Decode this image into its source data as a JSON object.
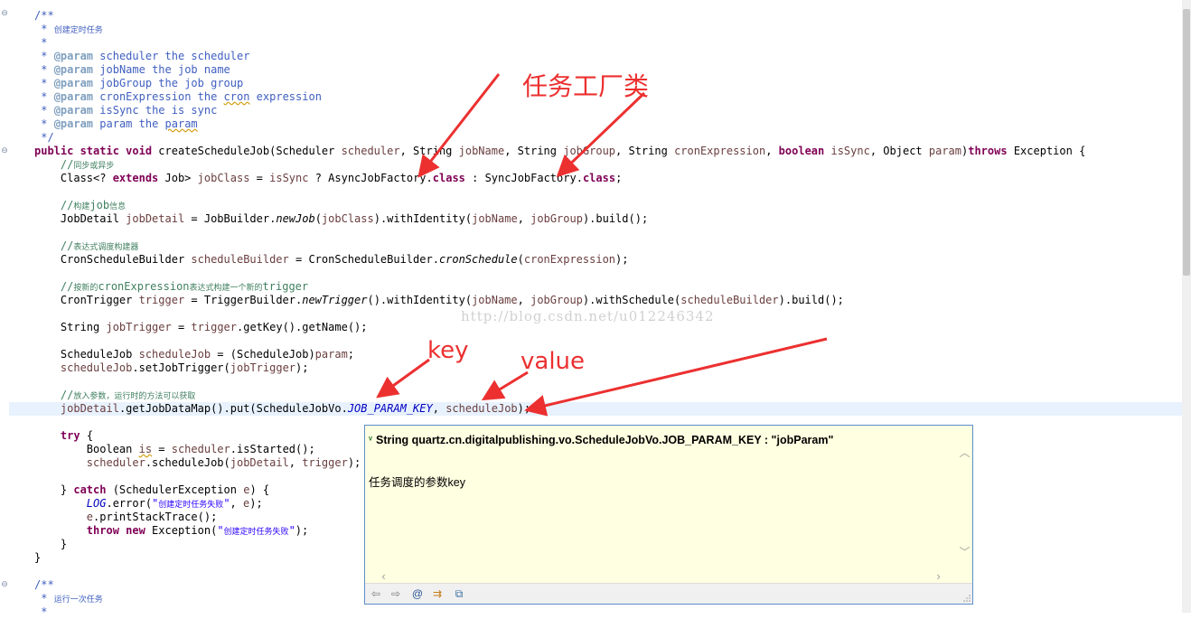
{
  "editor": {
    "lines": [
      {
        "parts": [
          {
            "t": "/**",
            "c": "doc"
          }
        ]
      },
      {
        "parts": [
          {
            "t": " * ",
            "c": "doc"
          },
          {
            "t": "创建定时任务",
            "c": "doc cjk"
          }
        ]
      },
      {
        "parts": [
          {
            "t": " *",
            "c": "doc"
          }
        ]
      },
      {
        "parts": [
          {
            "t": " * ",
            "c": "doc"
          },
          {
            "t": "@param",
            "c": "tag"
          },
          {
            "t": " scheduler the scheduler",
            "c": "doc"
          }
        ]
      },
      {
        "parts": [
          {
            "t": " * ",
            "c": "doc"
          },
          {
            "t": "@param",
            "c": "tag"
          },
          {
            "t": " jobName the job name",
            "c": "doc"
          }
        ]
      },
      {
        "parts": [
          {
            "t": " * ",
            "c": "doc"
          },
          {
            "t": "@param",
            "c": "tag"
          },
          {
            "t": " jobGroup the job group",
            "c": "doc"
          }
        ]
      },
      {
        "parts": [
          {
            "t": " * ",
            "c": "doc"
          },
          {
            "t": "@param",
            "c": "tag"
          },
          {
            "t": " cronExpression the ",
            "c": "doc"
          },
          {
            "t": "cron",
            "c": "doc sq"
          },
          {
            "t": " expression",
            "c": "doc"
          }
        ]
      },
      {
        "parts": [
          {
            "t": " * ",
            "c": "doc"
          },
          {
            "t": "@param",
            "c": "tag"
          },
          {
            "t": " isSync the is sync",
            "c": "doc"
          }
        ]
      },
      {
        "parts": [
          {
            "t": " * ",
            "c": "doc"
          },
          {
            "t": "@param",
            "c": "tag"
          },
          {
            "t": " param the ",
            "c": "doc"
          },
          {
            "t": "param",
            "c": "doc sq"
          }
        ]
      },
      {
        "parts": [
          {
            "t": " */",
            "c": "doc"
          }
        ]
      },
      {
        "parts": [
          {
            "t": "public static void",
            "c": "kw"
          },
          {
            "t": " createScheduleJob(Scheduler "
          },
          {
            "t": "scheduler",
            "c": "var"
          },
          {
            "t": ", String "
          },
          {
            "t": "jobName",
            "c": "var"
          },
          {
            "t": ", String "
          },
          {
            "t": "jobGroup",
            "c": "var"
          },
          {
            "t": ", String "
          },
          {
            "t": "cronExpression",
            "c": "var"
          },
          {
            "t": ", "
          },
          {
            "t": "boolean",
            "c": "kw"
          },
          {
            "t": " "
          },
          {
            "t": "isSync",
            "c": "var"
          },
          {
            "t": ", Object "
          },
          {
            "t": "param",
            "c": "var"
          },
          {
            "t": ")"
          },
          {
            "t": "throws",
            "c": "kw"
          },
          {
            "t": " Exception {"
          }
        ]
      },
      {
        "parts": [
          {
            "t": "    //",
            "c": "cm"
          },
          {
            "t": "同步或异步",
            "c": "cm cjk"
          }
        ]
      },
      {
        "parts": [
          {
            "t": "    Class<? "
          },
          {
            "t": "extends",
            "c": "kw"
          },
          {
            "t": " Job> "
          },
          {
            "t": "jobClass",
            "c": "var"
          },
          {
            "t": " = "
          },
          {
            "t": "isSync",
            "c": "var"
          },
          {
            "t": " ? AsyncJobFactory."
          },
          {
            "t": "class",
            "c": "kw"
          },
          {
            "t": " : SyncJobFactory."
          },
          {
            "t": "class",
            "c": "kw"
          },
          {
            "t": ";"
          }
        ]
      },
      {
        "parts": [
          {
            "t": ""
          }
        ]
      },
      {
        "parts": [
          {
            "t": "    //",
            "c": "cm"
          },
          {
            "t": "构建",
            "c": "cm cjk"
          },
          {
            "t": "job",
            "c": "cm"
          },
          {
            "t": "信息",
            "c": "cm cjk"
          }
        ]
      },
      {
        "parts": [
          {
            "t": "    JobDetail "
          },
          {
            "t": "jobDetail",
            "c": "var"
          },
          {
            "t": " = JobBuilder."
          },
          {
            "t": "newJob",
            "c": "it"
          },
          {
            "t": "("
          },
          {
            "t": "jobClass",
            "c": "var"
          },
          {
            "t": ").withIdentity("
          },
          {
            "t": "jobName",
            "c": "var"
          },
          {
            "t": ", "
          },
          {
            "t": "jobGroup",
            "c": "var"
          },
          {
            "t": ").build();"
          }
        ]
      },
      {
        "parts": [
          {
            "t": ""
          }
        ]
      },
      {
        "parts": [
          {
            "t": "    //",
            "c": "cm"
          },
          {
            "t": "表达式调度构建器",
            "c": "cm cjk"
          }
        ]
      },
      {
        "parts": [
          {
            "t": "    CronScheduleBuilder "
          },
          {
            "t": "scheduleBuilder",
            "c": "var"
          },
          {
            "t": " = CronScheduleBuilder."
          },
          {
            "t": "cronSchedule",
            "c": "it"
          },
          {
            "t": "("
          },
          {
            "t": "cronExpression",
            "c": "var"
          },
          {
            "t": ");"
          }
        ]
      },
      {
        "parts": [
          {
            "t": ""
          }
        ]
      },
      {
        "parts": [
          {
            "t": "    //",
            "c": "cm"
          },
          {
            "t": "按新的",
            "c": "cm cjk"
          },
          {
            "t": "cronExpression",
            "c": "cm"
          },
          {
            "t": "表达式构建一个新的",
            "c": "cm cjk"
          },
          {
            "t": "trigger",
            "c": "cm"
          }
        ]
      },
      {
        "parts": [
          {
            "t": "    CronTrigger "
          },
          {
            "t": "trigger",
            "c": "var"
          },
          {
            "t": " = TriggerBuilder."
          },
          {
            "t": "newTrigger",
            "c": "it"
          },
          {
            "t": "().withIdentity("
          },
          {
            "t": "jobName",
            "c": "var"
          },
          {
            "t": ", "
          },
          {
            "t": "jobGroup",
            "c": "var"
          },
          {
            "t": ").withSchedule("
          },
          {
            "t": "scheduleBuilder",
            "c": "var"
          },
          {
            "t": ").build();"
          }
        ]
      },
      {
        "parts": [
          {
            "t": ""
          }
        ]
      },
      {
        "parts": [
          {
            "t": "    String "
          },
          {
            "t": "jobTrigger",
            "c": "var"
          },
          {
            "t": " = "
          },
          {
            "t": "trigger",
            "c": "var"
          },
          {
            "t": ".getKey().getName();"
          }
        ]
      },
      {
        "parts": [
          {
            "t": ""
          }
        ]
      },
      {
        "parts": [
          {
            "t": "    ScheduleJob "
          },
          {
            "t": "scheduleJob",
            "c": "var"
          },
          {
            "t": " = (ScheduleJob)"
          },
          {
            "t": "param",
            "c": "var"
          },
          {
            "t": ";"
          }
        ]
      },
      {
        "parts": [
          {
            "t": "    "
          },
          {
            "t": "scheduleJob",
            "c": "var"
          },
          {
            "t": ".setJobTrigger("
          },
          {
            "t": "jobTrigger",
            "c": "var"
          },
          {
            "t": ");"
          }
        ]
      },
      {
        "parts": [
          {
            "t": ""
          }
        ]
      },
      {
        "parts": [
          {
            "t": "    //",
            "c": "cm"
          },
          {
            "t": "放入参数，运行时的方法可以获取",
            "c": "cm cjk"
          }
        ]
      },
      {
        "parts": [
          {
            "t": "    "
          },
          {
            "t": "jobDetail",
            "c": "var"
          },
          {
            "t": ".getJobDataMap().put(ScheduleJobVo."
          },
          {
            "t": "JOB_PARAM_KEY",
            "c": "fld"
          },
          {
            "t": ", "
          },
          {
            "t": "scheduleJob",
            "c": "var"
          },
          {
            "t": ");"
          }
        ]
      },
      {
        "parts": [
          {
            "t": ""
          }
        ]
      },
      {
        "parts": [
          {
            "t": "    "
          },
          {
            "t": "try",
            "c": "kw"
          },
          {
            "t": " {"
          }
        ]
      },
      {
        "parts": [
          {
            "t": "        Boolean "
          },
          {
            "t": "is",
            "c": "var sq"
          },
          {
            "t": " = "
          },
          {
            "t": "scheduler",
            "c": "var"
          },
          {
            "t": ".isStarted();"
          }
        ]
      },
      {
        "parts": [
          {
            "t": "        "
          },
          {
            "t": "scheduler",
            "c": "var"
          },
          {
            "t": ".scheduleJob("
          },
          {
            "t": "jobDetail",
            "c": "var"
          },
          {
            "t": ", "
          },
          {
            "t": "trigger",
            "c": "var"
          },
          {
            "t": ");"
          }
        ]
      },
      {
        "parts": [
          {
            "t": ""
          }
        ]
      },
      {
        "parts": [
          {
            "t": "    } "
          },
          {
            "t": "catch",
            "c": "kw"
          },
          {
            "t": " (SchedulerException "
          },
          {
            "t": "e",
            "c": "var"
          },
          {
            "t": ") {"
          }
        ]
      },
      {
        "parts": [
          {
            "t": "        "
          },
          {
            "t": "LOG",
            "c": "fld"
          },
          {
            "t": ".error("
          },
          {
            "t": "\"",
            "c": "str"
          },
          {
            "t": "创建定时任务失败",
            "c": "str cjk"
          },
          {
            "t": "\"",
            "c": "str"
          },
          {
            "t": ", "
          },
          {
            "t": "e",
            "c": "var"
          },
          {
            "t": ");"
          }
        ]
      },
      {
        "parts": [
          {
            "t": "        "
          },
          {
            "t": "e",
            "c": "var"
          },
          {
            "t": ".printStackTrace();"
          }
        ]
      },
      {
        "parts": [
          {
            "t": "        "
          },
          {
            "t": "throw new",
            "c": "kw"
          },
          {
            "t": " Exception("
          },
          {
            "t": "\"",
            "c": "str"
          },
          {
            "t": "创建定时任务失败",
            "c": "str cjk"
          },
          {
            "t": "\"",
            "c": "str"
          },
          {
            "t": ");"
          }
        ]
      },
      {
        "parts": [
          {
            "t": "    }"
          }
        ]
      },
      {
        "parts": [
          {
            "t": "}"
          }
        ]
      },
      {
        "parts": [
          {
            "t": ""
          }
        ]
      },
      {
        "parts": [
          {
            "t": "/**",
            "c": "doc"
          }
        ]
      },
      {
        "parts": [
          {
            "t": " * ",
            "c": "doc"
          },
          {
            "t": "运行一次任务",
            "c": "doc cjk"
          }
        ]
      },
      {
        "parts": [
          {
            "t": " *",
            "c": "doc"
          }
        ]
      }
    ],
    "fold_markers": [
      "⊖",
      "⊖",
      "⊖"
    ]
  },
  "watermark": "http://blog.csdn.net/u012246342",
  "annotations": {
    "factory_label": "任务工厂类",
    "key_label": "key",
    "value_label": "value",
    "color": "#ec3030"
  },
  "hover": {
    "signature": "String quartz.cn.digitalpublishing.vo.ScheduleJobVo.JOB_PARAM_KEY : \"jobParam\"",
    "description": "任务调度的参数key",
    "toolbar": {
      "back_icon": "⇦",
      "forward_icon": "⇨",
      "javadoc_icon": "@",
      "open_declaration_icon": "⇉",
      "open_browser_icon": "⧉"
    }
  }
}
